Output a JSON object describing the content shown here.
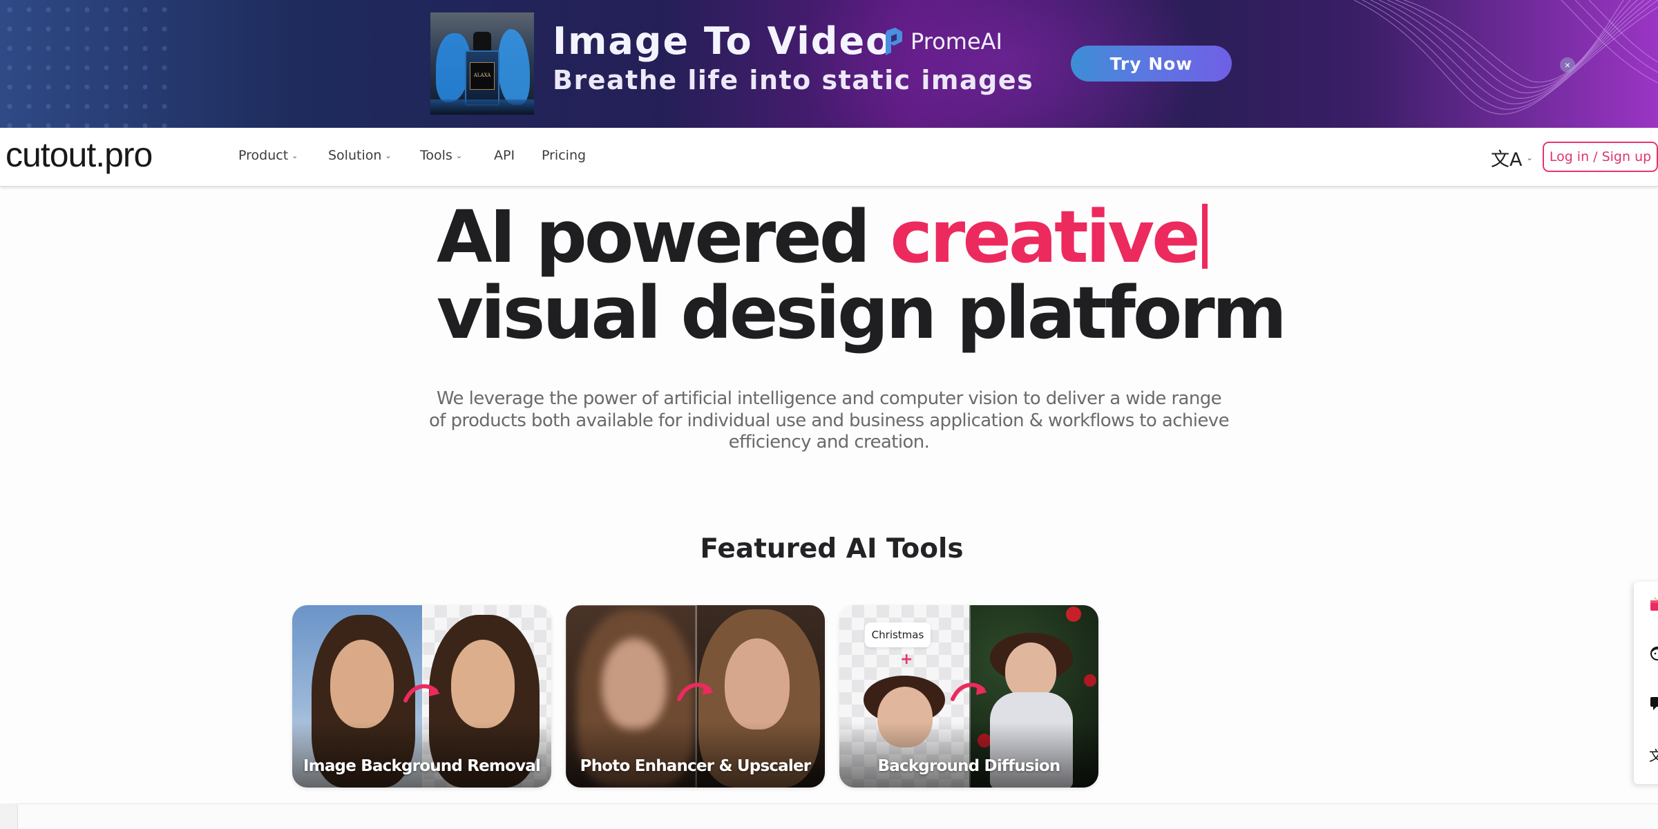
{
  "banner": {
    "title": "Image To Video",
    "subtitle": "Breathe life into static images",
    "brand": "PromeAI",
    "cta": "Try Now",
    "close_icon": "×"
  },
  "nav": {
    "logo": "cutout.pro",
    "items": [
      {
        "label": "Product",
        "has_dropdown": true
      },
      {
        "label": "Solution",
        "has_dropdown": true
      },
      {
        "label": "Tools",
        "has_dropdown": true
      },
      {
        "label": "API",
        "has_dropdown": false
      },
      {
        "label": "Pricing",
        "has_dropdown": false
      }
    ],
    "chevron": "⌄",
    "language_icon": "文A",
    "login": "Log in / Sign up"
  },
  "hero": {
    "headline_part1": "AI powered ",
    "headline_accent": "creative",
    "headline_line2": "visual design platform",
    "description": "We leverage the power of artificial intelligence and computer vision to deliver a wide range of products both available for individual use and business application & workflows to achieve efficiency and creation."
  },
  "featured": {
    "title": "Featured AI Tools",
    "cards": [
      {
        "title": "Image Background Removal"
      },
      {
        "title": "Photo Enhancer & Upscaler"
      },
      {
        "title": "Background Diffusion",
        "chip": "Christmas",
        "plus": "+"
      }
    ]
  },
  "side_tools": {
    "icons": [
      "gift-icon",
      "face-icon",
      "feedback-icon",
      "translate-icon"
    ]
  },
  "colors": {
    "accent": "#ec2a5e",
    "text_dark": "#1f1f22",
    "text_muted": "#6a6a6e",
    "cta_gradient_start": "#3d8ed6",
    "cta_gradient_end": "#6f5fe6"
  }
}
